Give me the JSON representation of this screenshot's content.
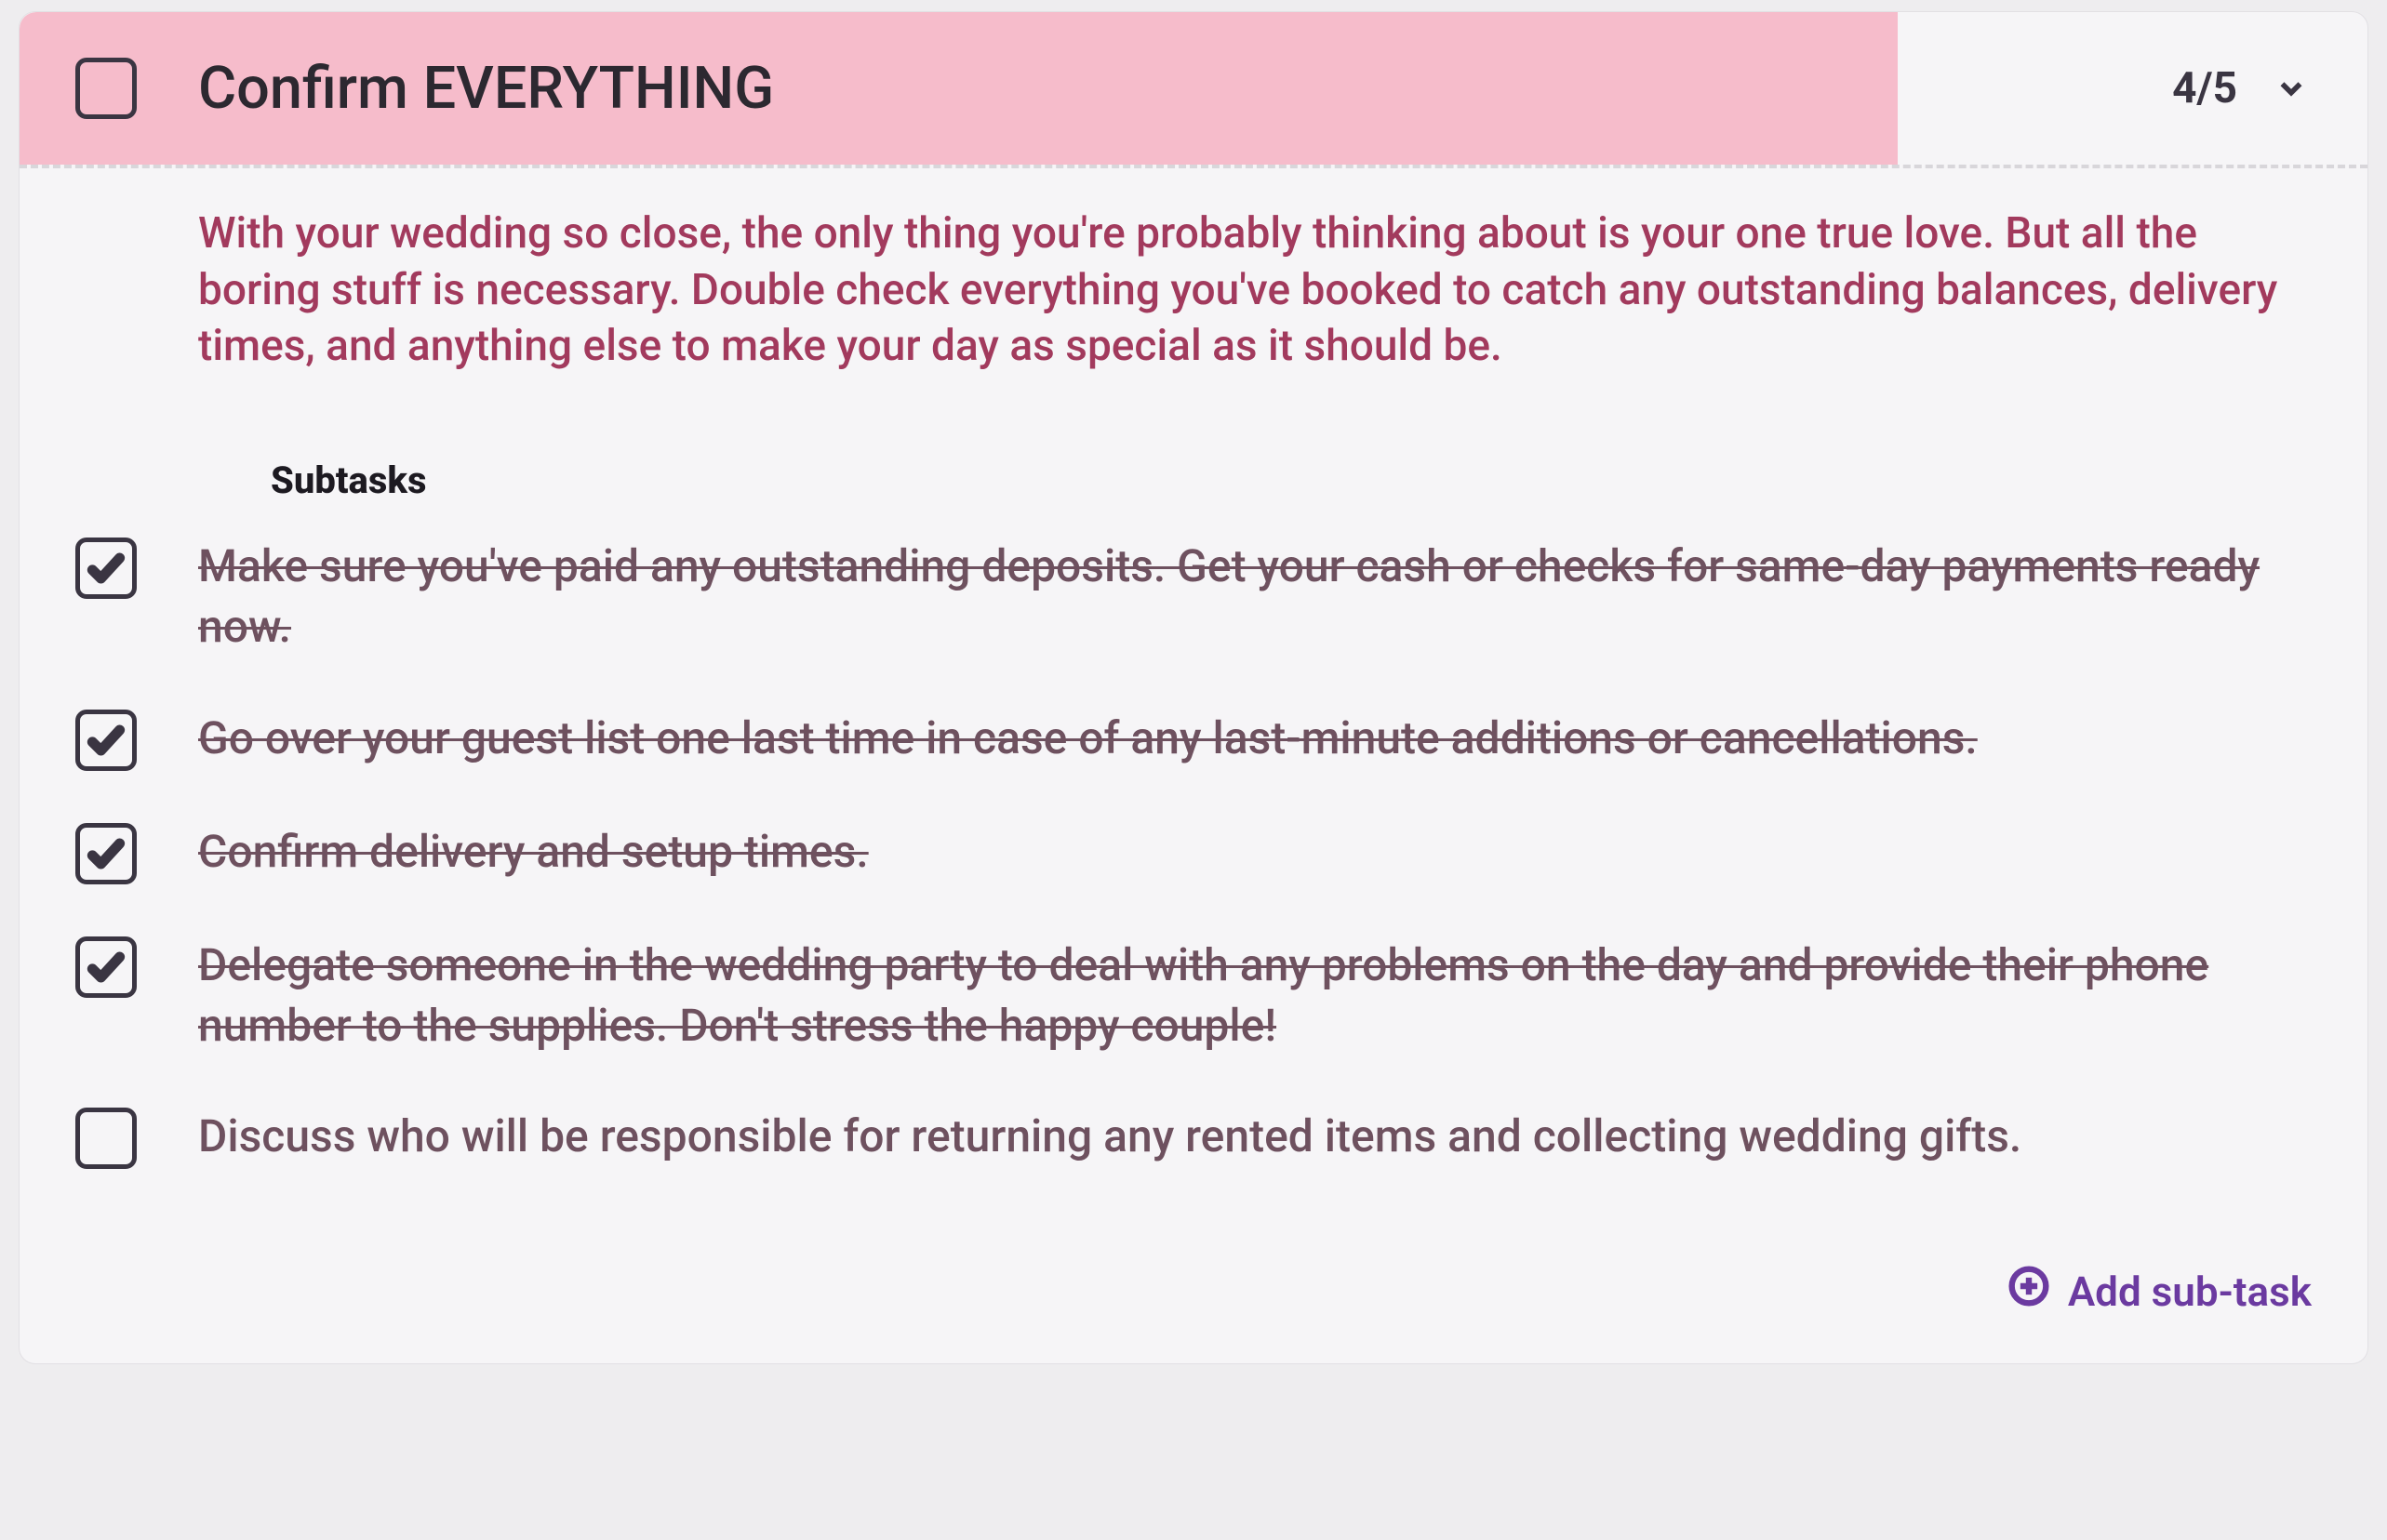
{
  "task": {
    "title": "Confirm EVERYTHING",
    "progress_label": "4/5",
    "completed": false,
    "description": "With your wedding so close, the only thing you're probably thinking about is your one true love. But all the boring stuff is necessary. Double check everything you've booked to catch any outstanding balances, delivery times, and anything else to make your day as special as it should be."
  },
  "subtasks_heading": "Subtasks",
  "subtasks": [
    {
      "done": true,
      "text": "Make sure you've paid any outstanding deposits. Get your cash or checks for same-day payments ready now."
    },
    {
      "done": true,
      "text": "Go over your guest list one last time in case of any last-minute additions or cancellations."
    },
    {
      "done": true,
      "text": "Confirm delivery and setup times."
    },
    {
      "done": true,
      "text": "Delegate someone in the wedding party to deal with any problems on the day and provide their phone number to the supplies. Don't stress the happy couple!"
    },
    {
      "done": false,
      "text": "Discuss who will be responsible for returning any rented items and collecting wedding gifts."
    }
  ],
  "add_subtask_label": "Add sub-task"
}
